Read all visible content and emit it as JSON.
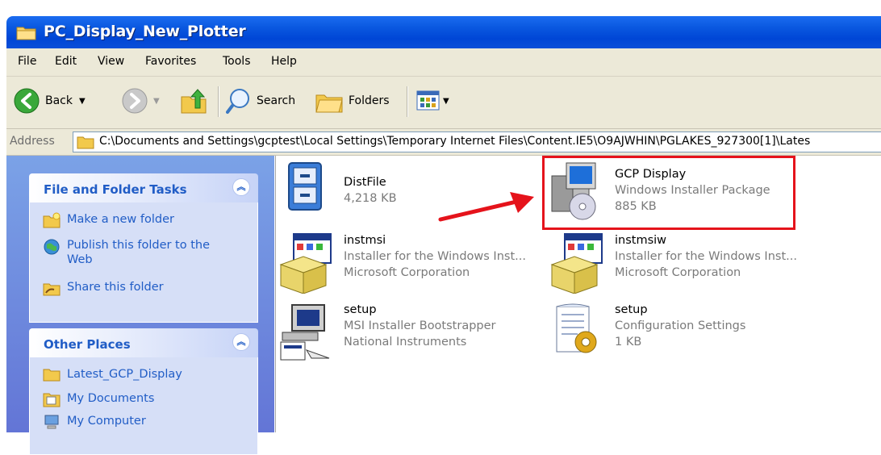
{
  "window": {
    "title": "PC_Display_New_Plotter"
  },
  "menu": [
    "File",
    "Edit",
    "View",
    "Favorites",
    "Tools",
    "Help"
  ],
  "toolbar": {
    "back": "Back",
    "search": "Search",
    "folders": "Folders"
  },
  "address": {
    "label": "Address",
    "path": "C:\\Documents and Settings\\gcptest\\Local Settings\\Temporary Internet Files\\Content.IE5\\O9AJWHIN\\PGLAKES_927300[1]\\Lates"
  },
  "tasks_panel": {
    "title": "File and Folder Tasks",
    "items": [
      {
        "label": "Make a new folder",
        "icon": "new-folder-icon"
      },
      {
        "label": "Publish this folder to the\nWeb",
        "icon": "publish-web-icon"
      },
      {
        "label": "Share this folder",
        "icon": "share-folder-icon"
      }
    ]
  },
  "places_panel": {
    "title": "Other Places",
    "items": [
      {
        "label": "Latest_GCP_Display",
        "icon": "folder-icon"
      },
      {
        "label": "My Documents",
        "icon": "my-documents-icon"
      },
      {
        "label": "My Computer",
        "icon": "my-computer-icon"
      }
    ]
  },
  "files": [
    {
      "name": "DistFile",
      "line1": "4,218 KB",
      "line2": "",
      "icon": "cabinet-file-icon"
    },
    {
      "name": "GCP Display",
      "line1": "Windows Installer Package",
      "line2": "885 KB",
      "icon": "installer-package-icon"
    },
    {
      "name": "instmsi",
      "line1": "Installer for the Windows Inst...",
      "line2": "Microsoft Corporation",
      "icon": "installer-exe-icon"
    },
    {
      "name": "instmsiw",
      "line1": "Installer for the Windows Inst...",
      "line2": "Microsoft Corporation",
      "icon": "installer-exe-icon"
    },
    {
      "name": "setup",
      "line1": "MSI Installer Bootstrapper",
      "line2": "National Instruments",
      "icon": "setup-computer-icon"
    },
    {
      "name": "setup",
      "line1": "Configuration Settings",
      "line2": "1 KB",
      "icon": "config-settings-icon"
    }
  ],
  "colors": {
    "titlebar": "#0a58e0",
    "taskpane": "#6f8fe0",
    "highlight": "#e5131b",
    "link": "#215dc6"
  }
}
